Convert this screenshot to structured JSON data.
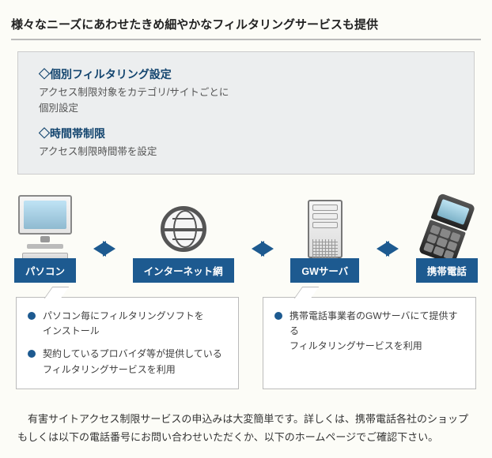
{
  "title": "様々なニーズにあわせたきめ細やかなフィルタリングサービスも提供",
  "info": {
    "h1": "◇個別フィルタリング設定",
    "t1": "アクセス制限対象をカテゴリ/サイトごとに\n個別設定",
    "h2": "◇時間帯制限",
    "t2": "アクセス制限時間帯を設定"
  },
  "nodes": {
    "pc": "パソコン",
    "net": "インターネット網",
    "gw": "GWサーバ",
    "mobile": "携帯電話"
  },
  "callout_left": [
    "パソコン毎にフィルタリングソフトを\nインストール",
    "契約しているプロバイダ等が提供している\nフィルタリングサービスを利用"
  ],
  "callout_right": [
    "携帯電話事業者のGWサーバにて提供する\nフィルタリングサービスを利用"
  ],
  "footer": "　有害サイトアクセス制限サービスの申込みは大変簡単です。詳しくは、携帯電話各社のショップもしくは以下の電話番号にお問い合わせいただくか、以下のホームページでご確認下さい。"
}
